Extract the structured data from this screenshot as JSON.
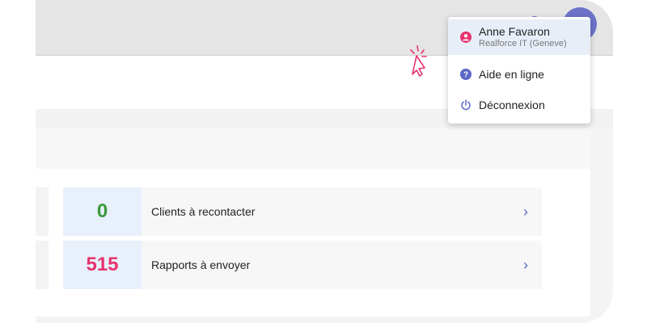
{
  "user_menu": {
    "user_name": "Anne Favaron",
    "user_org": "Realforce IT (Geneve)",
    "help_label": "Aide en ligne",
    "logout_label": "Déconnexion",
    "icons": {
      "user": "user-circle-icon",
      "help": "question-circle-icon",
      "logout": "power-icon"
    }
  },
  "dashboard": {
    "rows": [
      {
        "value": "0",
        "label": "Clients à recontacter",
        "value_color": "#3a9a3a",
        "chevron": "›"
      },
      {
        "value": "515",
        "label": "Rapports à envoyer",
        "value_color": "#e8336e",
        "chevron": "›"
      }
    ]
  },
  "colors": {
    "avatar": "#6c73c9",
    "accent": "#5a67c8",
    "cursor": "#e8336e",
    "user_icon": "#e8336e"
  }
}
